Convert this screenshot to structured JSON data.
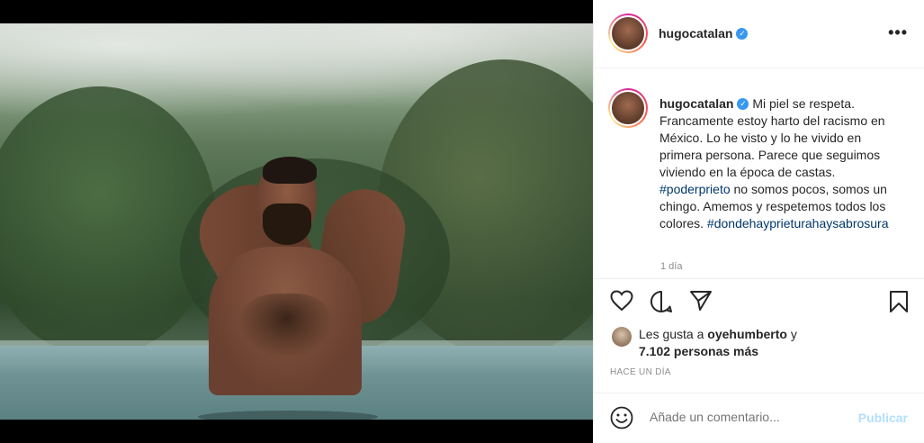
{
  "post": {
    "username": "hugocatalan",
    "caption_prefix": "Mi piel se respeta. Francamente estoy harto del racismo en México. Lo he visto y lo he vivido en primera persona. Parece que seguimos viviendo en la época de castas.",
    "hashtag_1": "#poderprieto",
    "caption_middle": "no somos pocos, somos un chingo. Amemos y respetemos todos los colores.",
    "hashtag_2": "#dondehayprieturahaysabrosura",
    "caption_time": "1 día"
  },
  "header": {
    "more_label": "•••"
  },
  "likes": {
    "prefix": "Les gusta a",
    "liker": "oyehumberto",
    "connector": "y",
    "others": "7.102 personas más"
  },
  "timeago": "HACE UN DÍA",
  "comment": {
    "placeholder": "Añade un comentario...",
    "publish_label": "Publicar"
  },
  "icons": {
    "verified": "verified-badge-icon",
    "like": "heart-icon",
    "comment": "comment-icon",
    "share": "share-icon",
    "save": "bookmark-icon",
    "emoji": "emoji-icon",
    "more": "more-options-icon"
  },
  "colors": {
    "verified": "#3897f0",
    "hashtag": "#00376b",
    "publish": "#b2dffc",
    "muted": "#8e8e8e"
  }
}
